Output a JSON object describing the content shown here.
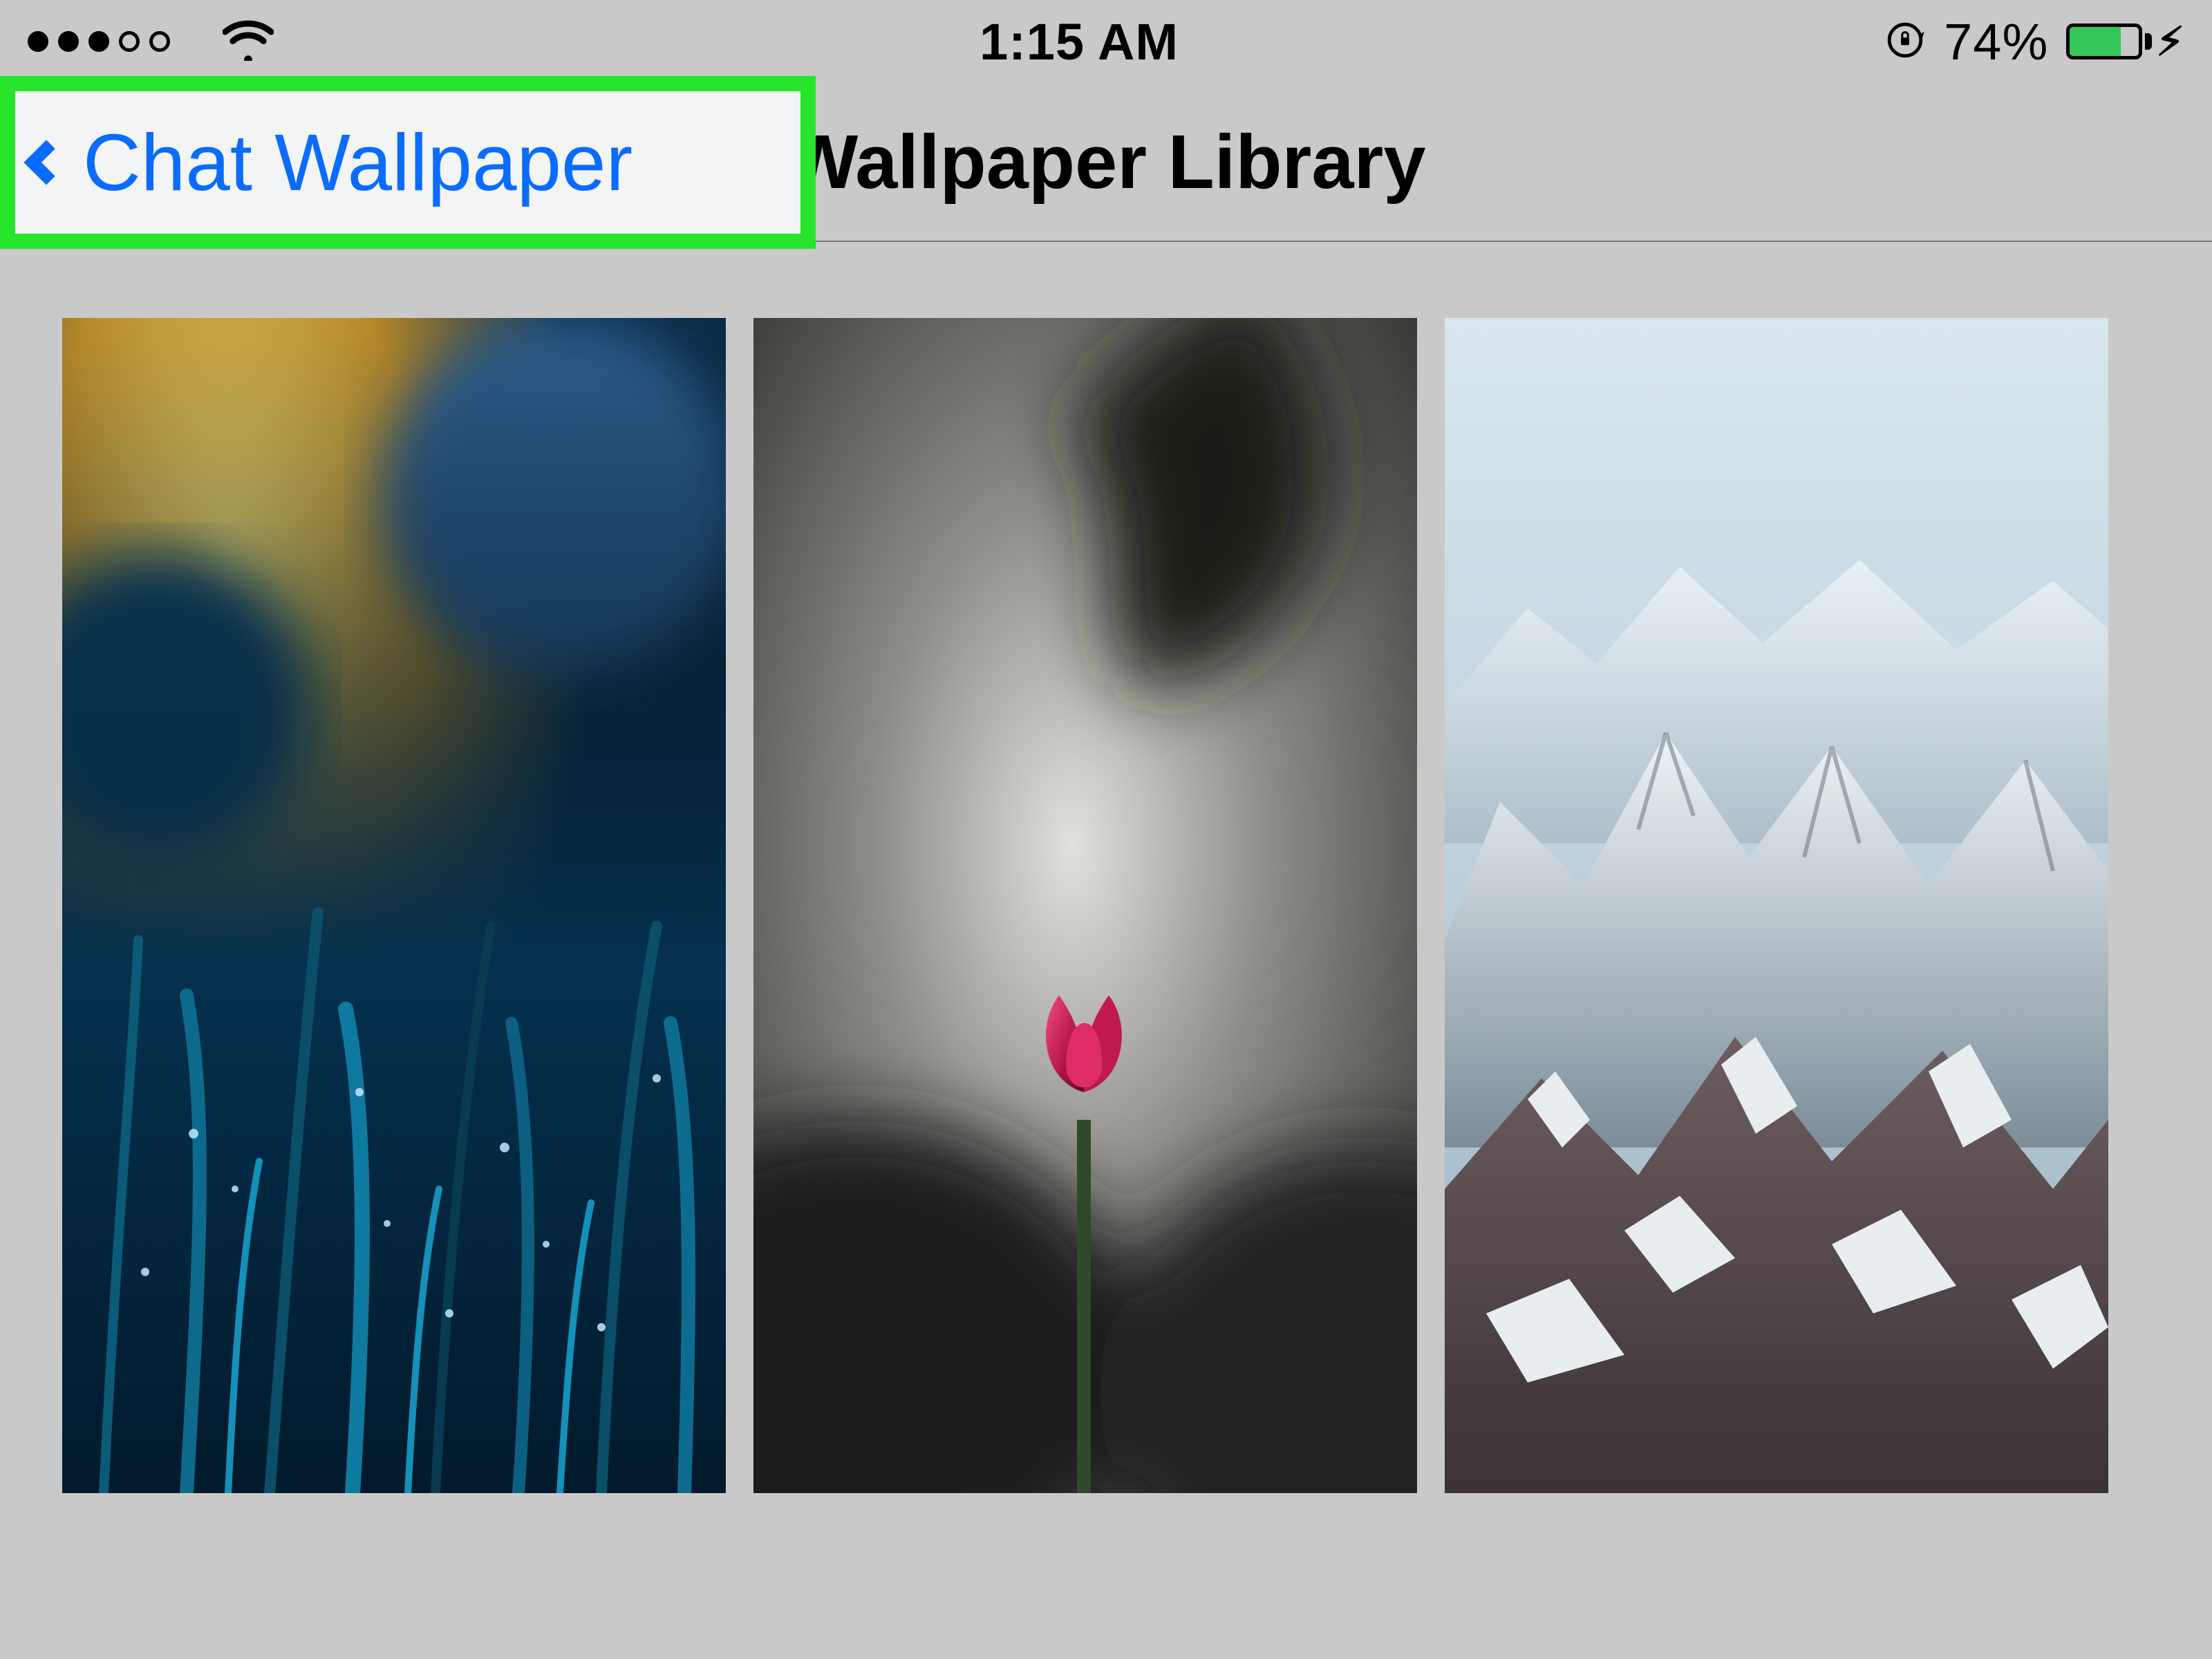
{
  "status_bar": {
    "time": "1:15 AM",
    "battery_percent": "74%",
    "signal_filled": 3,
    "signal_total": 5
  },
  "nav": {
    "back_label": "Chat Wallpaper",
    "title": "Wallpaper Library"
  },
  "highlight": {
    "color": "#26e52a"
  },
  "wallpapers": [
    {
      "name": "frosty-grass-bokeh"
    },
    {
      "name": "tulip-blur"
    },
    {
      "name": "snowy-mountains"
    }
  ]
}
